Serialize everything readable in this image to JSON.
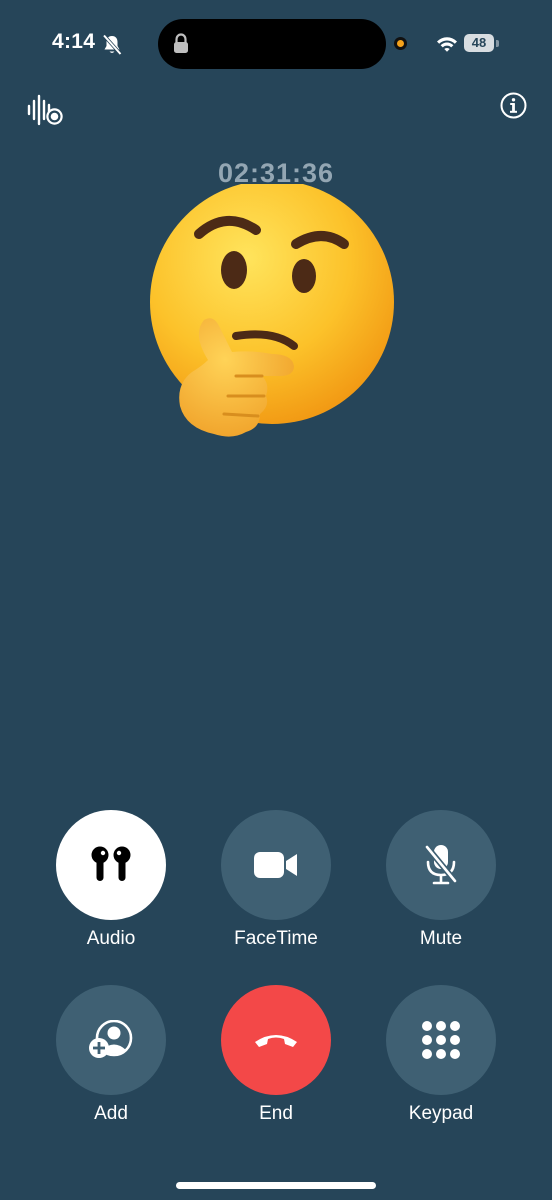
{
  "status_bar": {
    "time": "4:14",
    "battery_level": "48",
    "mic_indicator_color": "#f5a21b"
  },
  "call": {
    "timer": "02:31:36",
    "avatar_emoji": "thinking-face-emoji"
  },
  "controls": {
    "audio": "Audio",
    "facetime": "FaceTime",
    "mute": "Mute",
    "add": "Add",
    "end": "End",
    "keypad": "Keypad"
  },
  "colors": {
    "background": "#264559",
    "button": "#3f6073",
    "end_button": "#f34848",
    "timer_text": "#93a6b3"
  }
}
